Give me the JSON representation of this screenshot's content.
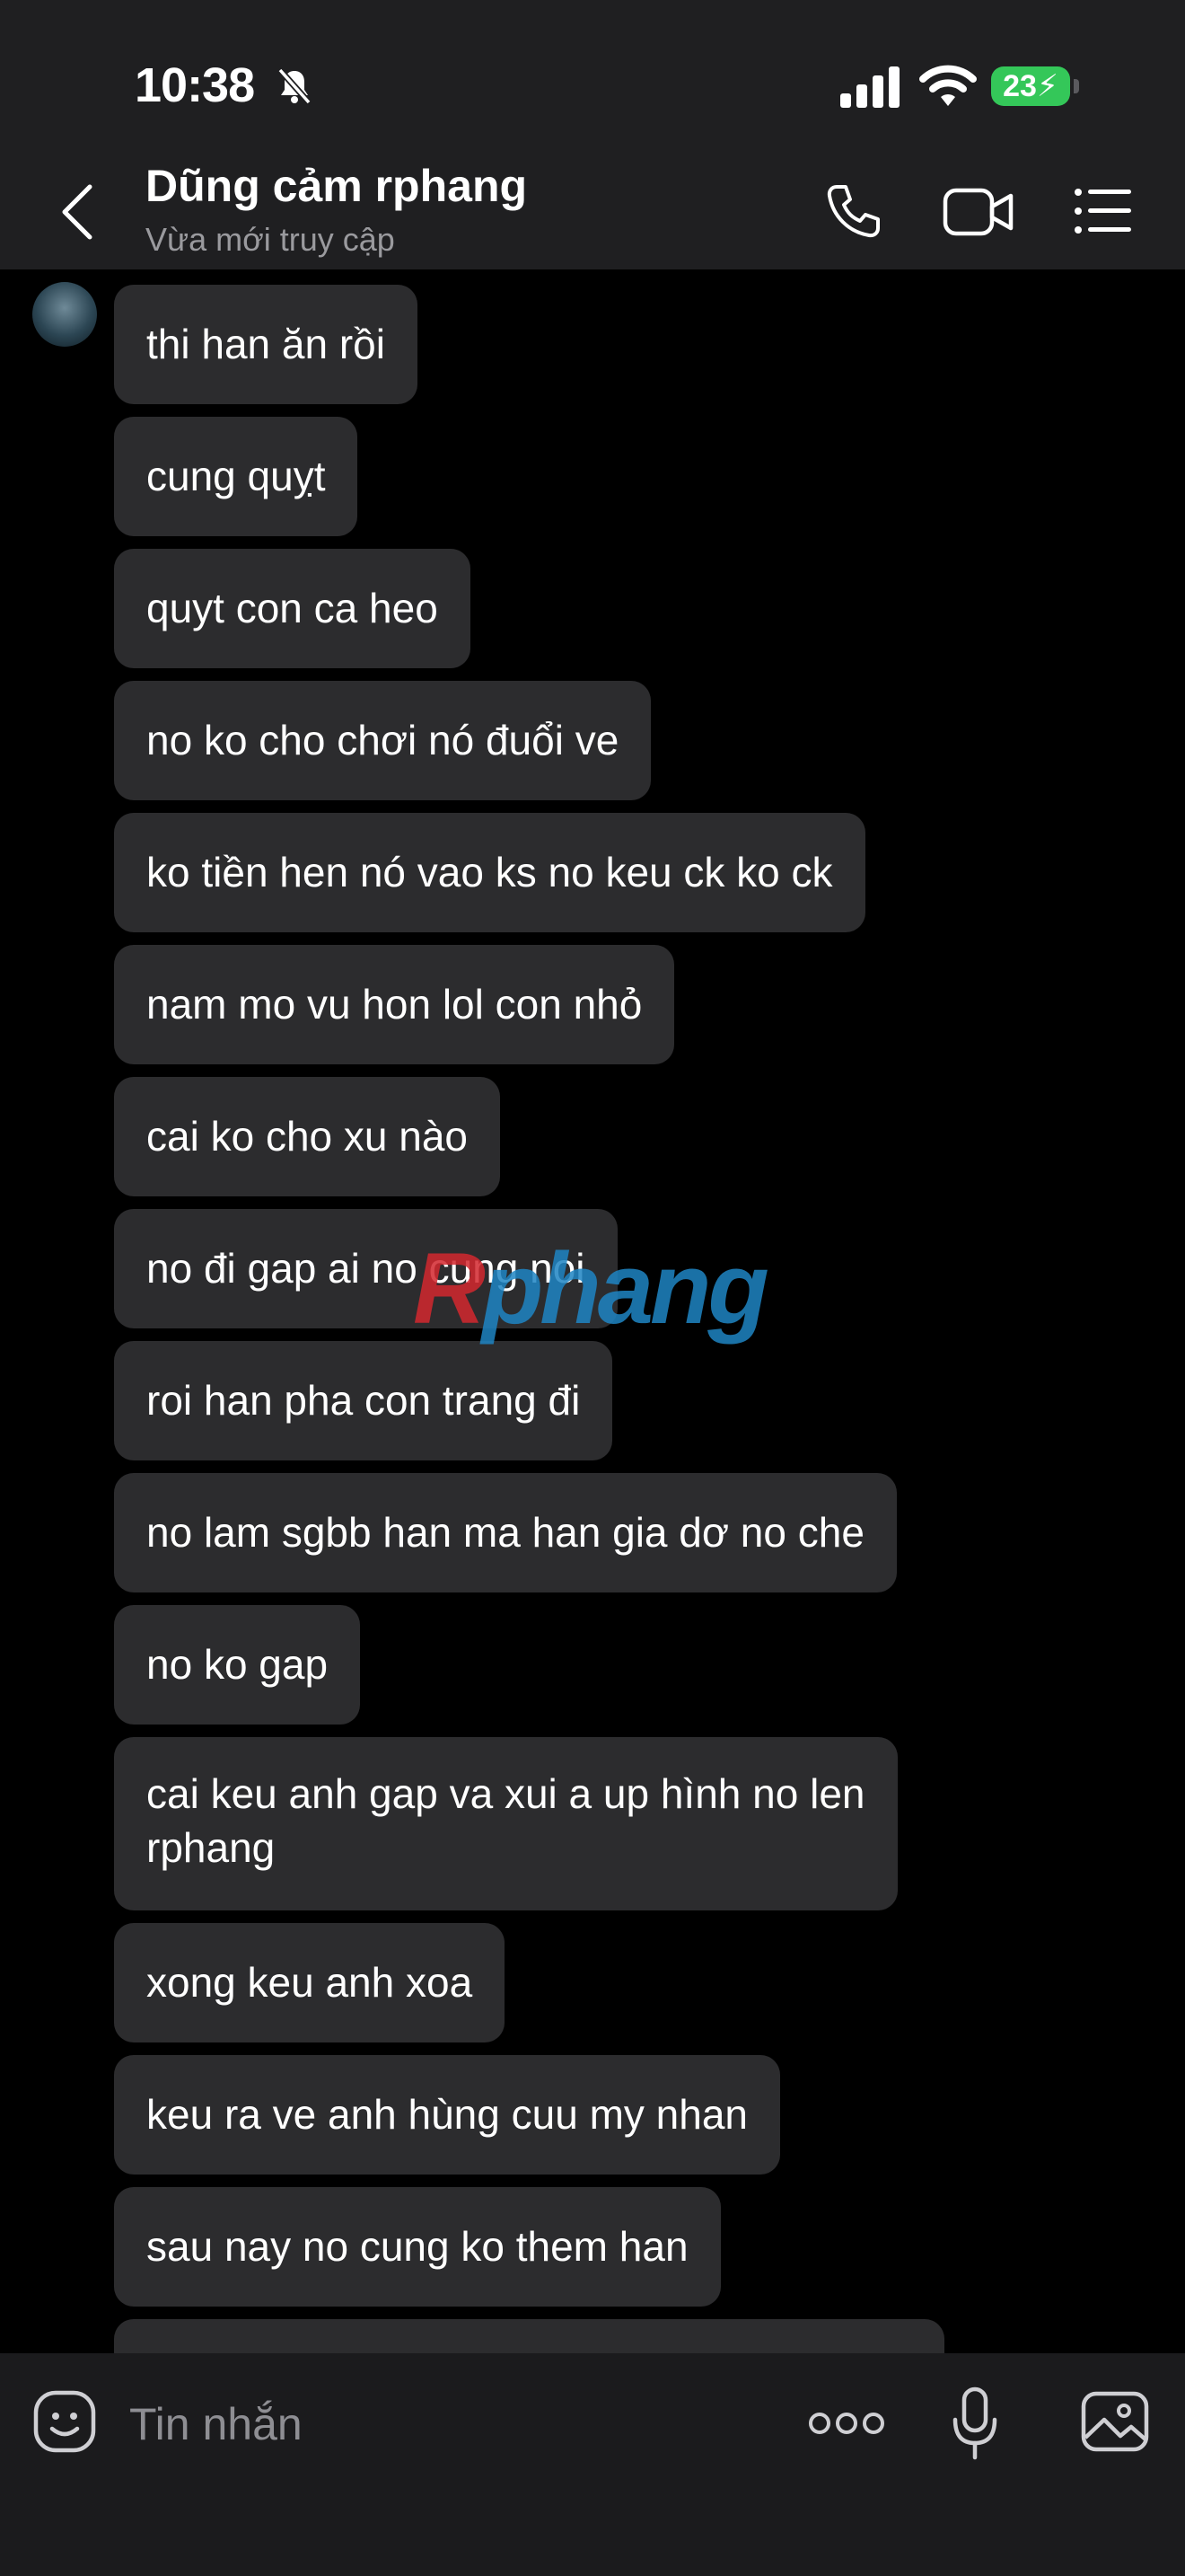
{
  "status_bar": {
    "time": "10:38",
    "battery": "23"
  },
  "header": {
    "contact_name": "Dũng cảm rphang",
    "contact_status": "Vừa mới truy cập"
  },
  "messages": [
    "thi han ăn rồi",
    "cung quỵt",
    "quyt con ca heo",
    "no ko cho chơi nó đuổi ve",
    "ko tiền hen nó vao ks no keu ck ko ck",
    "nam mo vu hon lol con nhỏ",
    "cai ko cho xu nào",
    "no đi gap ai no cung noi",
    "roi han pha con trang đi",
    "no lam sgbb han ma han gia dơ no che",
    "no ko gap",
    "cai keu anh gap va xui a up hình no len",
    "rphang",
    "xong keu anh xoa",
    "keu ra ve anh hùng cuu my nhan",
    "sau nay no cung ko them han"
  ],
  "watermark": {
    "first": "R",
    "rest": "phang"
  },
  "composer": {
    "placeholder": "Tin nhắn"
  },
  "colors": {
    "bubble": "#2c2c2e",
    "background": "#000000",
    "header": "#1f1f21",
    "battery": "#34c759"
  },
  "icons": [
    "silent-bell-icon",
    "signal-icon",
    "wifi-icon",
    "back-chevron-icon",
    "phone-icon",
    "video-camera-icon",
    "list-menu-icon",
    "emoji-icon",
    "more-dots-icon",
    "microphone-icon",
    "image-icon"
  ]
}
